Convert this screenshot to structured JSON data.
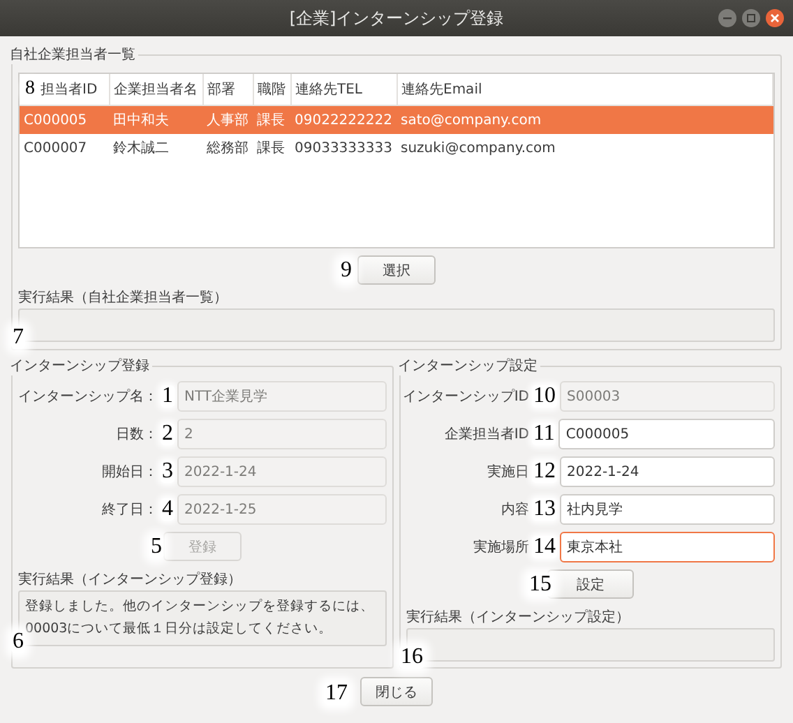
{
  "window": {
    "title": "[企業]インターンシップ登録"
  },
  "staff_list": {
    "title": "自社企業担当者一覧",
    "marker": "8",
    "columns": [
      "担当者ID",
      "企業担当者名",
      "部署",
      "職階",
      "連絡先TEL",
      "連絡先Email"
    ],
    "rows": [
      {
        "cells": [
          "C000005",
          "田中和夫",
          "人事部",
          "課長",
          "09022222222",
          "sato@company.com"
        ],
        "selected": true
      },
      {
        "cells": [
          "C000007",
          "鈴木誠二",
          "総務部",
          "課長",
          "09033333333",
          "suzuki@company.com"
        ],
        "selected": false
      }
    ],
    "select_button": {
      "label": "選択",
      "marker": "9"
    },
    "result": {
      "title": "実行結果（自社企業担当者一覧）",
      "marker": "7"
    }
  },
  "registration": {
    "title": "インターンシップ登録",
    "fields": [
      {
        "label": "インターンシップ名：",
        "value": "NTT企業見学",
        "marker": "1",
        "disabled": true,
        "focused": false
      },
      {
        "label": "日数：",
        "value": "2",
        "marker": "2",
        "disabled": true,
        "focused": false
      },
      {
        "label": "開始日：",
        "value": "2022-1-24",
        "marker": "3",
        "disabled": true,
        "focused": false
      },
      {
        "label": "終了日：",
        "value": "2022-1-25",
        "marker": "4",
        "disabled": true,
        "focused": false
      }
    ],
    "button": {
      "label": "登録",
      "marker": "5",
      "disabled": true
    },
    "result": {
      "title": "実行結果（インターンシップ登録）",
      "marker": "6",
      "message": "登録しました。他のインターンシップを登録するには、\n00003について最低１日分は設定してください。"
    }
  },
  "settings": {
    "title": "インターンシップ設定",
    "fields": [
      {
        "label": "インターンシップID",
        "value": "S00003",
        "marker": "10",
        "disabled": true,
        "focused": false
      },
      {
        "label": "企業担当者ID",
        "value": "C000005",
        "marker": "11",
        "disabled": false,
        "focused": false
      },
      {
        "label": "実施日",
        "value": "2022-1-24",
        "marker": "12",
        "disabled": false,
        "focused": false
      },
      {
        "label": "内容",
        "value": "社内見学",
        "marker": "13",
        "disabled": false,
        "focused": false
      },
      {
        "label": "実施場所",
        "value": "東京本社",
        "marker": "14",
        "disabled": false,
        "focused": true
      }
    ],
    "button": {
      "label": "設定",
      "marker": "15",
      "disabled": false
    },
    "result": {
      "title": "実行結果（インターンシップ設定）",
      "marker": "16"
    }
  },
  "close_button": {
    "label": "閉じる",
    "marker": "17"
  }
}
